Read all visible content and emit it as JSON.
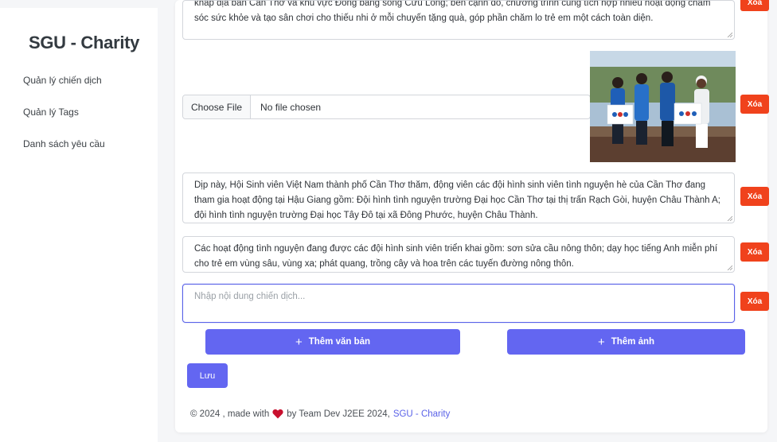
{
  "sidebar": {
    "brand": "SGU - Charity",
    "items": [
      {
        "label": "Quản lý chiến dịch"
      },
      {
        "label": "Quản lý Tags"
      },
      {
        "label": "Danh sách yêu cầu"
      }
    ]
  },
  "blocks": {
    "text1": "khắp địa bàn Cần Thơ và khu vực Đồng bằng sông Cửu Long; bên cạnh đó, chương trình cũng tích hợp nhiều hoạt động chăm sóc sức khỏe và tạo sân chơi cho thiếu nhi ở mỗi chuyến tặng quà, góp phần chăm lo trẻ em một cách toàn diện.",
    "file_button": "Choose File",
    "file_status": "No file chosen",
    "text2": "Dịp này, Hội Sinh viên Việt Nam thành phố Cần Thơ thăm, động viên các đội hình sinh viên tình nguyện hè của Cần Thơ đang tham gia hoạt động tại Hậu Giang gồm: Đội hình tình nguyện trường Đại học Cần Thơ tại thị trấn Rạch Gòi, huyện Châu Thành A; đội hình tình nguyện trường Đại học Tây Đô tại xã Đông Phước, huyện Châu Thành.",
    "text3": "Các hoạt động tình nguyện đang được các đội hình sinh viên triển khai gồm: sơn sửa cầu nông thôn; dạy học tiếng Anh miễn phí cho trẻ em vùng sâu, vùng xa; phát quang, trồng cây và hoa trên các tuyến đường nông thôn.",
    "new_placeholder": "Nhập nội dung chiến dịch...",
    "delete_label": "Xóa"
  },
  "actions": {
    "add_text": "Thêm văn bản",
    "add_image": "Thêm ảnh",
    "save": "Lưu"
  },
  "footer": {
    "prefix": "© 2024 , made with",
    "middle": "by Team Dev J2EE 2024,",
    "link": "SGU - Charity"
  },
  "colors": {
    "primary": "#6366f1",
    "danger": "#f0421c",
    "heart": "#c8102e"
  }
}
